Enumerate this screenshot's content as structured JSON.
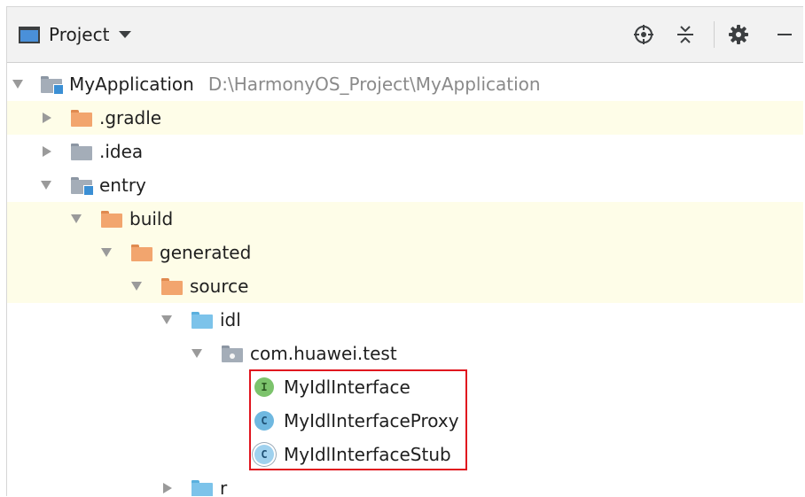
{
  "header": {
    "view_label": "Project",
    "tools": [
      "crosshair-locate-icon",
      "collapse-all-icon",
      "gear-icon",
      "minimize-icon"
    ]
  },
  "tree": {
    "root": {
      "name": "MyApplication",
      "path": "D:\\HarmonyOS_Project\\MyApplication"
    },
    "gradle": ".gradle",
    "idea": ".idea",
    "entry": "entry",
    "build": "build",
    "generated": "generated",
    "source": "source",
    "idl": "idl",
    "package": "com.huawei.test",
    "files": [
      {
        "name": "MyIdlInterface",
        "icon_letter": "I",
        "kind": "interface"
      },
      {
        "name": "MyIdlInterfaceProxy",
        "icon_letter": "C",
        "kind": "class"
      },
      {
        "name": "MyIdlInterfaceStub",
        "icon_letter": "C",
        "kind": "class"
      }
    ],
    "r": "r"
  },
  "colors": {
    "highlight_row": "#fefde8",
    "folder_orange": "#f2a56e",
    "folder_blue": "#7cc3ea",
    "folder_gray": "#a4adb8",
    "annotation_box": "#e0141e"
  }
}
